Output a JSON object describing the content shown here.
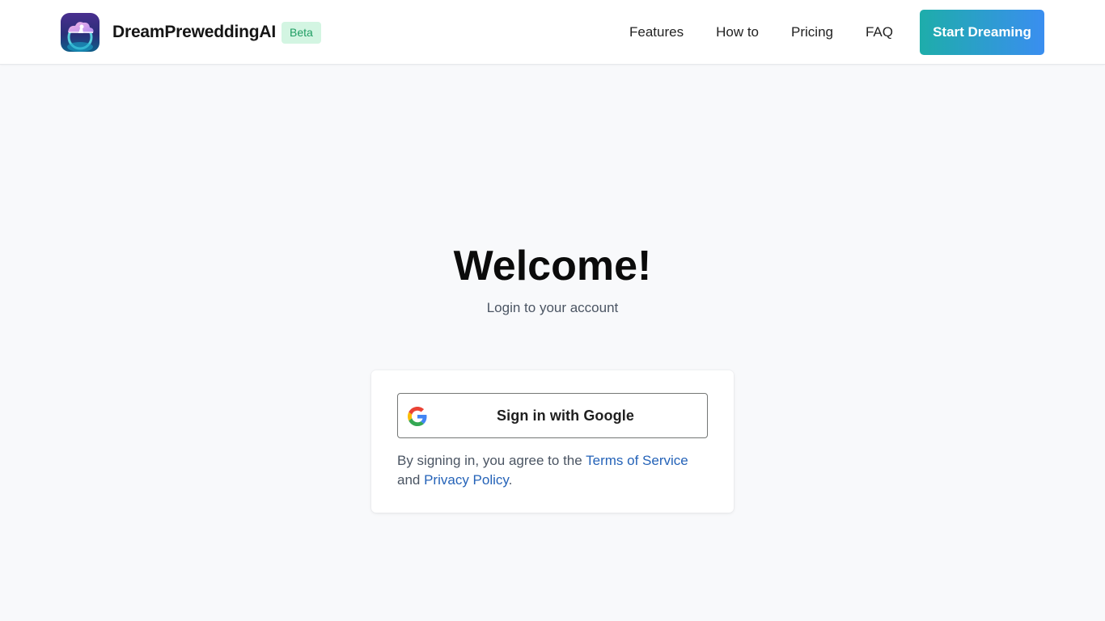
{
  "header": {
    "brand_name": "DreamPreweddingAI",
    "badge": "Beta",
    "nav": [
      "Features",
      "How to",
      "Pricing",
      "FAQ"
    ],
    "cta_label": "Start Dreaming"
  },
  "hero": {
    "title": "Welcome!",
    "subtitle": "Login to your account"
  },
  "login_card": {
    "google_button_label": "Sign in with Google",
    "legal": {
      "prefix": "By signing in, you agree to the ",
      "terms_link": "Terms of Service",
      "middle": " and ",
      "privacy_link": "Privacy Policy",
      "suffix": "."
    }
  },
  "colors": {
    "accent_gradient_start": "#1eadaa",
    "accent_gradient_end": "#3a8ef0",
    "link": "#2563b8",
    "badge_bg": "#d3f5e2",
    "badge_text": "#1f9d63",
    "page_bg": "#f8f9fb"
  },
  "icons": {
    "logo": "dream-cloud-logo-icon",
    "google": "google-g-icon"
  }
}
